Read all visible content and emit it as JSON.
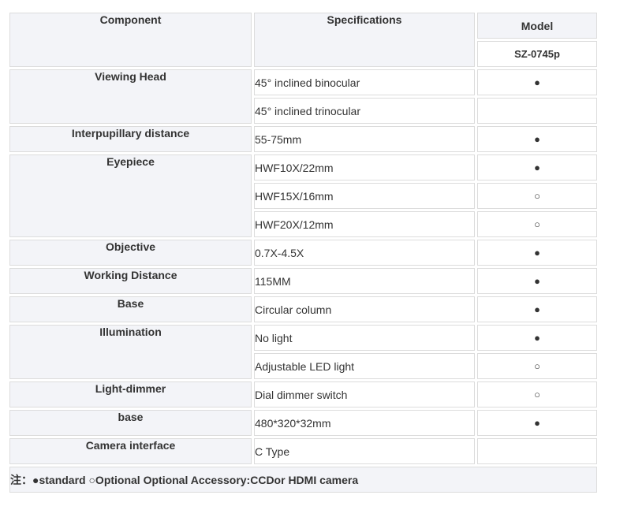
{
  "header": {
    "component": "Component",
    "specifications": "Specifications",
    "model": "Model",
    "model_name": "SZ-0745p"
  },
  "rows": {
    "viewing_head": {
      "label": "Viewing Head",
      "opts": [
        {
          "spec": "45° inclined binocular",
          "mark": "●"
        },
        {
          "spec": "45° inclined trinocular",
          "mark": ""
        }
      ]
    },
    "interpupillary": {
      "label": "Interpupillary distance",
      "spec": "55-75mm",
      "mark": "●"
    },
    "eyepiece": {
      "label": "Eyepiece",
      "opts": [
        {
          "spec": "HWF10X/22mm",
          "mark": "●"
        },
        {
          "spec": "HWF15X/16mm",
          "mark": "○"
        },
        {
          "spec": "HWF20X/12mm",
          "mark": "○"
        }
      ]
    },
    "objective": {
      "label": "Objective",
      "spec": "0.7X-4.5X",
      "mark": "●"
    },
    "working_distance": {
      "label": "Working Distance",
      "spec": "115MM",
      "mark": "●"
    },
    "base": {
      "label": "Base",
      "spec": "Circular column",
      "mark": "●"
    },
    "illumination": {
      "label": "Illumination",
      "opts": [
        {
          "spec": "No light",
          "mark": "●"
        },
        {
          "spec": "Adjustable LED light",
          "mark": "○"
        }
      ]
    },
    "light_dimmer": {
      "label": "Light-dimmer",
      "spec": "Dial dimmer switch",
      "mark": "○"
    },
    "base2": {
      "label": "base",
      "spec": "480*320*32mm",
      "mark": "●"
    },
    "camera": {
      "label": "Camera interface",
      "spec": "C Type",
      "mark": ""
    }
  },
  "note": "注：●standard ○Optional Optional Accessory:CCDor HDMI camera"
}
